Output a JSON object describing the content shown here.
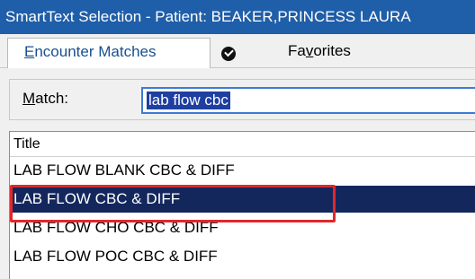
{
  "window": {
    "title": "SmartText Selection - Patient:  BEAKER,PRINCESS LAURA"
  },
  "tabs": [
    {
      "label_prefix": "",
      "mnemonic": "E",
      "label_rest": "ncounter Matches"
    },
    {
      "label_prefix": "Fa",
      "mnemonic": "v",
      "label_rest": "orites"
    }
  ],
  "search": {
    "label_mnemonic": "M",
    "label_rest": "atch:",
    "value": "lab flow cbc"
  },
  "list": {
    "column_header": "Title",
    "rows": [
      "LAB FLOW BLANK CBC & DIFF",
      "LAB FLOW CBC & DIFF",
      "LAB FLOW CHO CBC & DIFF",
      "LAB FLOW POC CBC & DIFF"
    ],
    "selected_row": "LAB FLOW CBC & DIFF"
  },
  "colors": {
    "titlebar": "#1f5ea8",
    "selection": "#14275d",
    "annotation": "#e0282a",
    "input_focus": "#3c7bd8"
  },
  "icons": {
    "favorites_tab_icon": "check-circle-icon"
  }
}
